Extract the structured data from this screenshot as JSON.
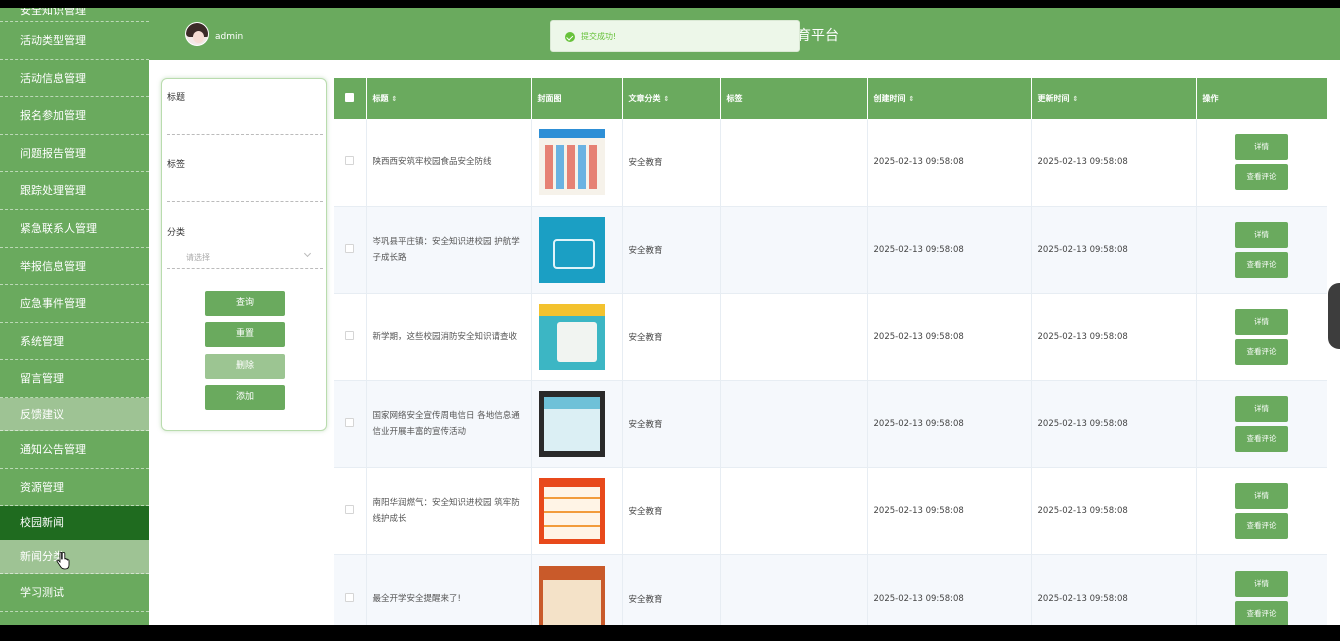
{
  "sidebar": {
    "items": [
      {
        "label": "安全知识管理"
      },
      {
        "label": "活动类型管理"
      },
      {
        "label": "活动信息管理"
      },
      {
        "label": "报名参加管理"
      },
      {
        "label": "问题报告管理"
      },
      {
        "label": "跟踪处理管理"
      },
      {
        "label": "紧急联系人管理"
      },
      {
        "label": "举报信息管理"
      },
      {
        "label": "应急事件管理"
      },
      {
        "label": "系统管理"
      },
      {
        "label": "留言管理"
      },
      {
        "label": "反馈建议"
      },
      {
        "label": "通知公告管理"
      },
      {
        "label": "资源管理"
      },
      {
        "label": "校园新闻"
      },
      {
        "label": "新闻分类"
      },
      {
        "label": "学习测试"
      }
    ]
  },
  "header": {
    "user": "admin",
    "title": "育平台"
  },
  "toast": {
    "message": "提交成功!"
  },
  "search": {
    "title_label": "标题",
    "tag_label": "标签",
    "category_label": "分类",
    "category_placeholder": "请选择",
    "query_button": "查询",
    "reset_button": "重置",
    "delete_button": "删除",
    "add_button": "添加"
  },
  "table": {
    "headers": [
      "标题",
      "封面图",
      "文章分类",
      "标签",
      "创建时间",
      "更新时间",
      "操作"
    ],
    "detail_button": "详情",
    "comment_button": "查看评论",
    "rows": [
      {
        "title": "陕西西安筑牢校园食品安全防线",
        "category": "安全教育",
        "tag": "",
        "created": "2025-02-13 09:58:08",
        "updated": "2025-02-13 09:58:08"
      },
      {
        "title": "岑巩县平庄镇：安全知识进校园 护航学子成长路",
        "category": "安全教育",
        "tag": "",
        "created": "2025-02-13 09:58:08",
        "updated": "2025-02-13 09:58:08"
      },
      {
        "title": "新学期，这些校园消防安全知识请查收",
        "category": "安全教育",
        "tag": "",
        "created": "2025-02-13 09:58:08",
        "updated": "2025-02-13 09:58:08"
      },
      {
        "title": "国家网络安全宣传周电信日 各地信息通信业开展丰富的宣传活动",
        "category": "安全教育",
        "tag": "",
        "created": "2025-02-13 09:58:08",
        "updated": "2025-02-13 09:58:08"
      },
      {
        "title": "南阳华润燃气：安全知识进校园 筑牢防线护成长",
        "category": "安全教育",
        "tag": "",
        "created": "2025-02-13 09:58:08",
        "updated": "2025-02-13 09:58:08"
      },
      {
        "title": "最全开学安全提醒来了!",
        "category": "安全教育",
        "tag": "",
        "created": "2025-02-13 09:58:08",
        "updated": "2025-02-13 09:58:08"
      }
    ]
  },
  "icons": {
    "toast": "check-circle-icon",
    "select": "chevron-down-icon",
    "cursor": "hand-pointer-icon"
  },
  "colors": {
    "primary": "#6aaa5e",
    "active_dark": "#1f6b1f",
    "highlight": "#9ec394",
    "success": "#67c23a"
  }
}
